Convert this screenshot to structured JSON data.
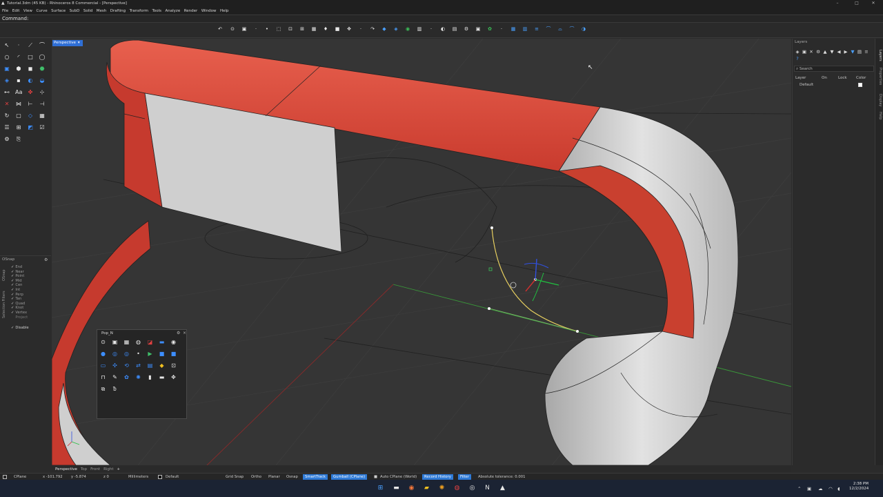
{
  "window": {
    "title": "Tutorial.3dm (45 KB) - Rhinoceros 8 Commercial - [Perspective]",
    "controls": [
      "–",
      "□",
      "✕"
    ]
  },
  "menu": [
    "File",
    "Edit",
    "View",
    "Curve",
    "Surface",
    "SubD",
    "Solid",
    "Mesh",
    "Drafting",
    "Transform",
    "Tools",
    "Analyze",
    "Render",
    "Window",
    "Help"
  ],
  "command": {
    "label": "Command:"
  },
  "viewport": {
    "active_label": "Perspective",
    "tabs": [
      "Perspective",
      "Top",
      "Front",
      "Right"
    ],
    "add_tab": "+"
  },
  "osnap": {
    "title": "OSnap",
    "side_tabs": [
      "OSnap",
      "Selection Filters"
    ],
    "items": [
      {
        "label": "End",
        "checked": true
      },
      {
        "label": "Near",
        "checked": true
      },
      {
        "label": "Point",
        "checked": true
      },
      {
        "label": "Mid",
        "checked": true
      },
      {
        "label": "Cen",
        "checked": true
      },
      {
        "label": "Int",
        "checked": true
      },
      {
        "label": "Perp",
        "checked": true
      },
      {
        "label": "Tan",
        "checked": true
      },
      {
        "label": "Quad",
        "checked": true
      },
      {
        "label": "Knot",
        "checked": true
      },
      {
        "label": "Vertex",
        "checked": true
      },
      {
        "label": "Project",
        "checked": false
      }
    ],
    "disable": {
      "label": "Disable",
      "checked": true
    }
  },
  "popup": {
    "title": "Pop_N"
  },
  "layers": {
    "title": "Layers",
    "search_placeholder": "Search",
    "columns": [
      "Layer",
      "On",
      "Lock",
      "Color"
    ],
    "rows": [
      {
        "name": "Default"
      }
    ]
  },
  "right_side_tabs": [
    "Layers",
    "Properties",
    "Display",
    "Help"
  ],
  "status": {
    "cplane": "CPlane",
    "x": "x -101.792",
    "y": "y -5.874",
    "z": "z 0",
    "units": "Millimeters",
    "layer": "Default",
    "grid_snap": "Grid Snap",
    "ortho": "Ortho",
    "planar": "Planar",
    "osnap": "Osnap",
    "smarttrack": "SmartTrack",
    "gumball": "Gumball (CPlane)",
    "auto_cplane": "Auto CPlane (World)",
    "record_history": "Record History",
    "filter": "Filter",
    "tolerance": "Absolute tolerance: 0.001"
  },
  "taskbar": {
    "time": "2:38 PM",
    "date": "12/2/2024"
  },
  "colors": {
    "accent": "#2f7ad6",
    "surface_red": "#d9473a",
    "surface_white": "#d6d6d6",
    "viewport_bg": "#353535"
  }
}
